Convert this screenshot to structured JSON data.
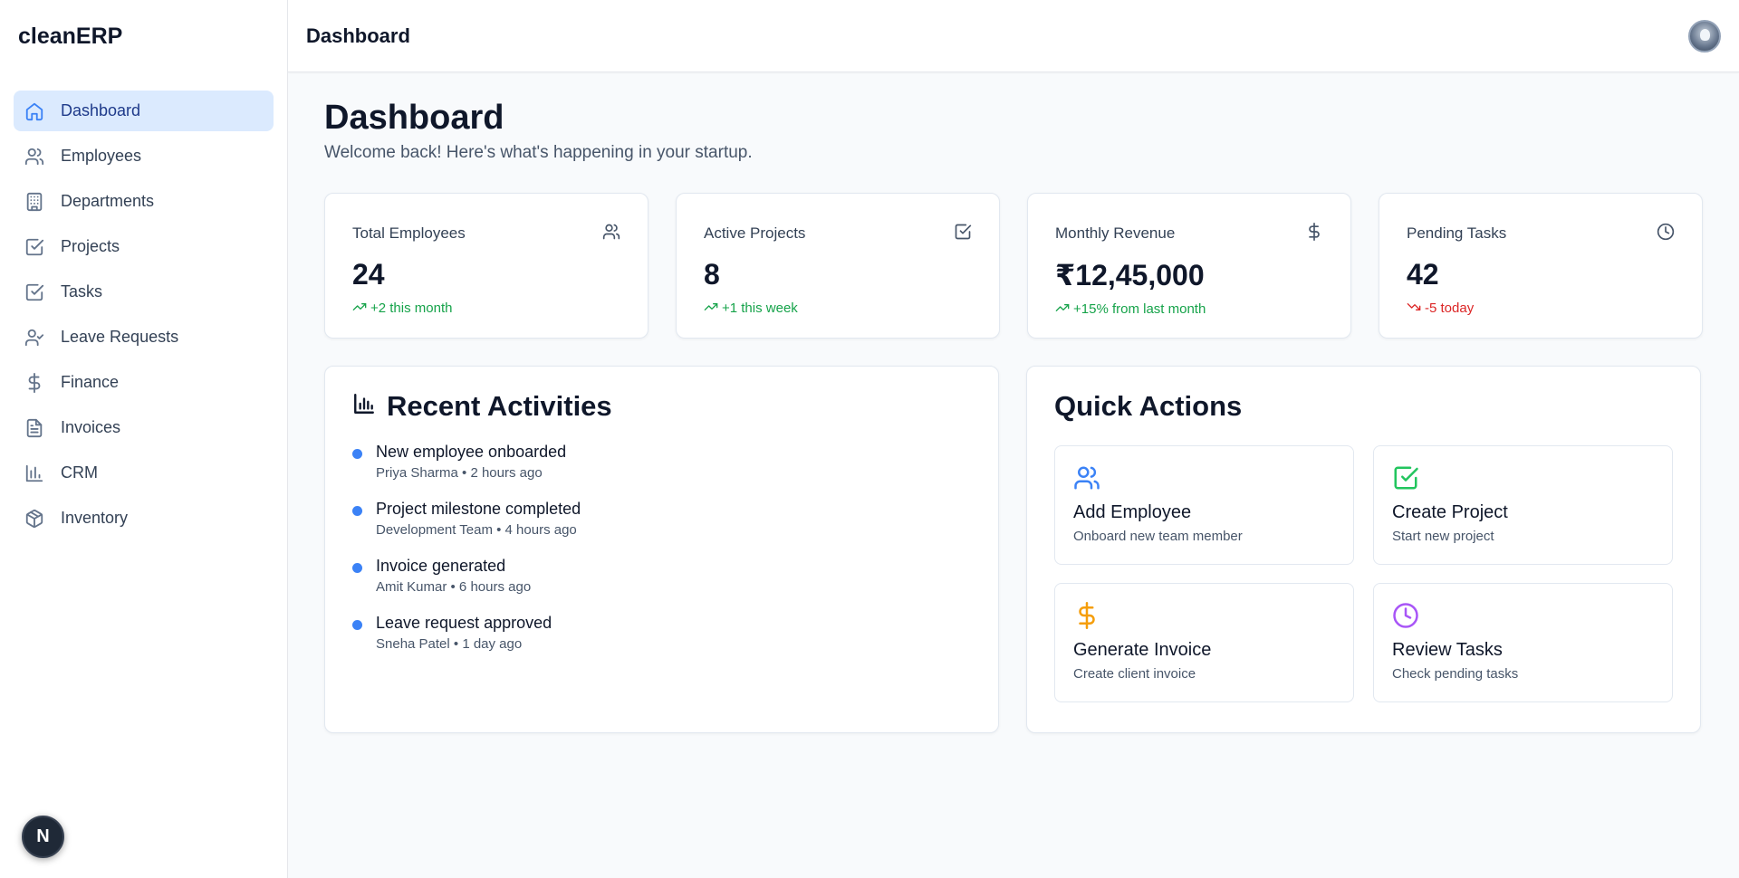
{
  "brand": "cleanERP",
  "nav": [
    {
      "label": "Dashboard",
      "icon": "home-icon",
      "active": true
    },
    {
      "label": "Employees",
      "icon": "users-icon"
    },
    {
      "label": "Departments",
      "icon": "building-icon"
    },
    {
      "label": "Projects",
      "icon": "check-square-icon"
    },
    {
      "label": "Tasks",
      "icon": "check-square-icon"
    },
    {
      "label": "Leave Requests",
      "icon": "user-check-icon"
    },
    {
      "label": "Finance",
      "icon": "dollar-icon"
    },
    {
      "label": "Invoices",
      "icon": "file-text-icon"
    },
    {
      "label": "CRM",
      "icon": "bar-chart-icon"
    },
    {
      "label": "Inventory",
      "icon": "package-icon"
    }
  ],
  "badge": "N",
  "topbar": {
    "title": "Dashboard"
  },
  "page": {
    "title": "Dashboard",
    "subtitle": "Welcome back! Here's what's happening in your startup."
  },
  "stats": [
    {
      "label": "Total Employees",
      "value": "24",
      "change": "+2 this month",
      "trend": "up",
      "icon": "users-icon"
    },
    {
      "label": "Active Projects",
      "value": "8",
      "change": "+1 this week",
      "trend": "up",
      "icon": "check-square-icon"
    },
    {
      "label": "Monthly Revenue",
      "value": "₹12,45,000",
      "change": "+15% from last month",
      "trend": "up",
      "icon": "dollar-icon"
    },
    {
      "label": "Pending Tasks",
      "value": "42",
      "change": "-5 today",
      "trend": "down",
      "icon": "clock-icon"
    }
  ],
  "activities": {
    "title": "Recent Activities",
    "items": [
      {
        "title": "New employee onboarded",
        "meta": "Priya Sharma • 2 hours ago"
      },
      {
        "title": "Project milestone completed",
        "meta": "Development Team • 4 hours ago"
      },
      {
        "title": "Invoice generated",
        "meta": "Amit Kumar • 6 hours ago"
      },
      {
        "title": "Leave request approved",
        "meta": "Sneha Patel • 1 day ago"
      }
    ]
  },
  "quick": {
    "title": "Quick Actions",
    "items": [
      {
        "title": "Add Employee",
        "sub": "Onboard new team member",
        "icon": "users-icon",
        "color": "#3b82f6"
      },
      {
        "title": "Create Project",
        "sub": "Start new project",
        "icon": "check-square-icon",
        "color": "#22c55e"
      },
      {
        "title": "Generate Invoice",
        "sub": "Create client invoice",
        "icon": "dollar-icon",
        "color": "#f59e0b"
      },
      {
        "title": "Review Tasks",
        "sub": "Check pending tasks",
        "icon": "clock-icon",
        "color": "#a855f7"
      }
    ]
  },
  "colors": {
    "accent": "#3b82f6",
    "up": "#16a34a",
    "down": "#dc2626"
  }
}
